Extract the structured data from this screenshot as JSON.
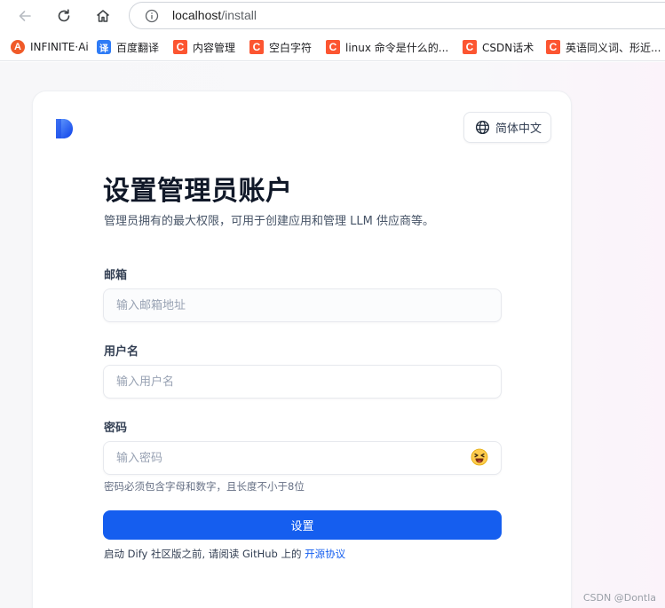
{
  "browser": {
    "url_host": "localhost",
    "url_path": "/install",
    "bookmarks": [
      {
        "label": "INFINITE·Ai",
        "icon": "infinite-ai-logo-icon",
        "icon_glyph": "A"
      },
      {
        "label": "百度翻译",
        "icon": "baidu-translate-icon",
        "icon_glyph": "译"
      },
      {
        "label": "内容管理",
        "icon": "csdn-icon",
        "icon_glyph": "C"
      },
      {
        "label": "空白字符",
        "icon": "csdn-icon",
        "icon_glyph": "C"
      },
      {
        "label": "linux 命令是什么的...",
        "icon": "csdn-icon",
        "icon_glyph": "C"
      },
      {
        "label": "CSDN话术",
        "icon": "csdn-icon",
        "icon_glyph": "C"
      },
      {
        "label": "英语同义词、形近...",
        "icon": "csdn-icon",
        "icon_glyph": "C"
      }
    ]
  },
  "header": {
    "language_label": "简体中文"
  },
  "form": {
    "title": "设置管理员账户",
    "subtitle": "管理员拥有的最大权限，可用于创建应用和管理 LLM 供应商等。",
    "email": {
      "label": "邮箱",
      "placeholder": "输入邮箱地址",
      "value": ""
    },
    "username": {
      "label": "用户名",
      "placeholder": "输入用户名",
      "value": ""
    },
    "password": {
      "label": "密码",
      "placeholder": "输入密码",
      "value": "",
      "toggle_icon": "emoji-face-icon"
    },
    "password_hint": "密码必须包含字母和数字，且长度不小于8位",
    "submit_label": "设置",
    "license_prefix": "启动 Dify 社区版之前, 请阅读 GitHub 上的 ",
    "license_link": "开源协议"
  },
  "watermark": "CSDN @Dontla",
  "colors": {
    "primary": "#155eef",
    "csdn_red": "#fc5531",
    "title": "#101828"
  }
}
